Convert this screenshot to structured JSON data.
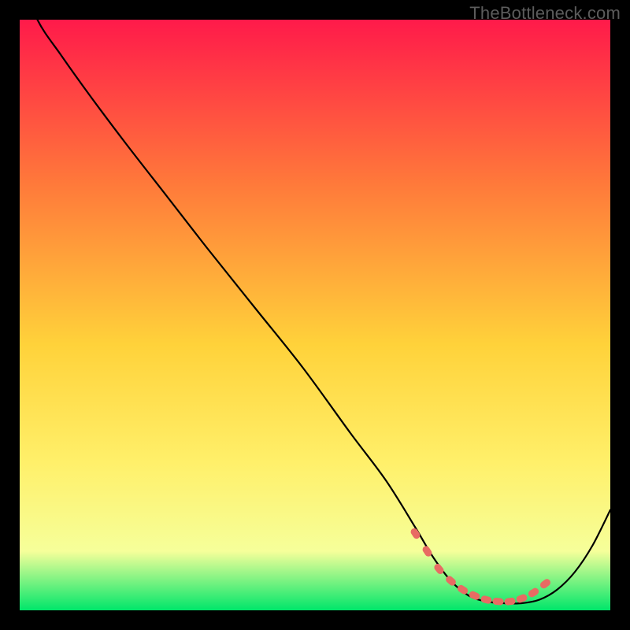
{
  "watermark": "TheBottleneck.com",
  "colors": {
    "frame": "#000000",
    "gradient_top": "#ff1a4a",
    "gradient_mid1": "#ff7a3a",
    "gradient_mid2": "#ffd23a",
    "gradient_mid3": "#fff06a",
    "gradient_mid4": "#f6ff9a",
    "gradient_bottom": "#00e66a",
    "curve": "#000000",
    "markers": "#e86b63"
  },
  "chart_data": {
    "type": "line",
    "title": "",
    "xlabel": "",
    "ylabel": "",
    "xlim": [
      0,
      100
    ],
    "ylim": [
      0,
      100
    ],
    "series": [
      {
        "name": "bottleneck-curve",
        "x": [
          0,
          3,
          7,
          12,
          18,
          25,
          32,
          40,
          48,
          56,
          62,
          67,
          70,
          73,
          76,
          79,
          82,
          85,
          88,
          91,
          94,
          97,
          100
        ],
        "y": [
          108,
          100,
          94,
          87,
          79,
          70,
          61,
          51,
          41,
          30,
          22,
          14,
          9,
          5,
          2.5,
          1.5,
          1.2,
          1.2,
          1.8,
          3.5,
          6.5,
          11,
          17
        ]
      }
    ],
    "markers": {
      "name": "highlight-band",
      "x": [
        67,
        69,
        71,
        73,
        75,
        77,
        79,
        81,
        83,
        85,
        87,
        89
      ],
      "y": [
        13,
        10,
        7,
        5,
        3.5,
        2.5,
        1.8,
        1.5,
        1.5,
        2.0,
        3.0,
        4.5
      ]
    }
  }
}
